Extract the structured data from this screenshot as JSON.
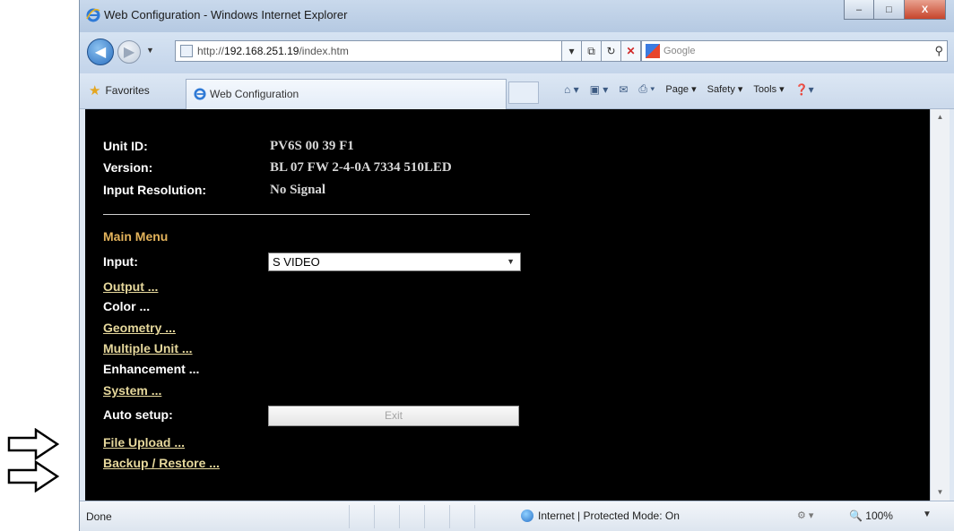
{
  "window": {
    "title": "Web Configuration - Windows Internet Explorer",
    "minimize": "–",
    "maximize": "□",
    "close": "X"
  },
  "addressbar": {
    "url_prefix": "http://",
    "url_host": "192.168.251.19",
    "url_path": "/index.htm",
    "search_placeholder": "Google"
  },
  "favorites_bar": {
    "favorites_label": "Favorites",
    "tab_label": "Web Configuration",
    "page_menu": "Page ▾",
    "safety_menu": "Safety ▾",
    "tools_menu": "Tools ▾"
  },
  "info": {
    "unit_id_label": "Unit ID:",
    "unit_id_value": "PV6S 00 39 F1",
    "version_label": "Version:",
    "version_value": "BL 07 FW 2-4-0A 7334 510LED",
    "input_resolution_label": "Input Resolution:",
    "input_resolution_value": "No Signal"
  },
  "menu": {
    "title": "Main Menu",
    "input_label": "Input:",
    "input_selected": "S VIDEO",
    "output_link": "Output ...",
    "color_label": "Color ...",
    "geometry_link": "Geometry ...",
    "multiple_unit_link": "Multiple Unit ...",
    "enhancement_label": "Enhancement ...",
    "system_link": "System ...",
    "auto_setup_label": "Auto setup:",
    "exit_button": "Exit",
    "file_upload_link": "File Upload ...",
    "backup_restore_link": "Backup / Restore ..."
  },
  "statusbar": {
    "status": "Done",
    "zone": "Internet | Protected Mode: On",
    "zoom": "100%"
  }
}
